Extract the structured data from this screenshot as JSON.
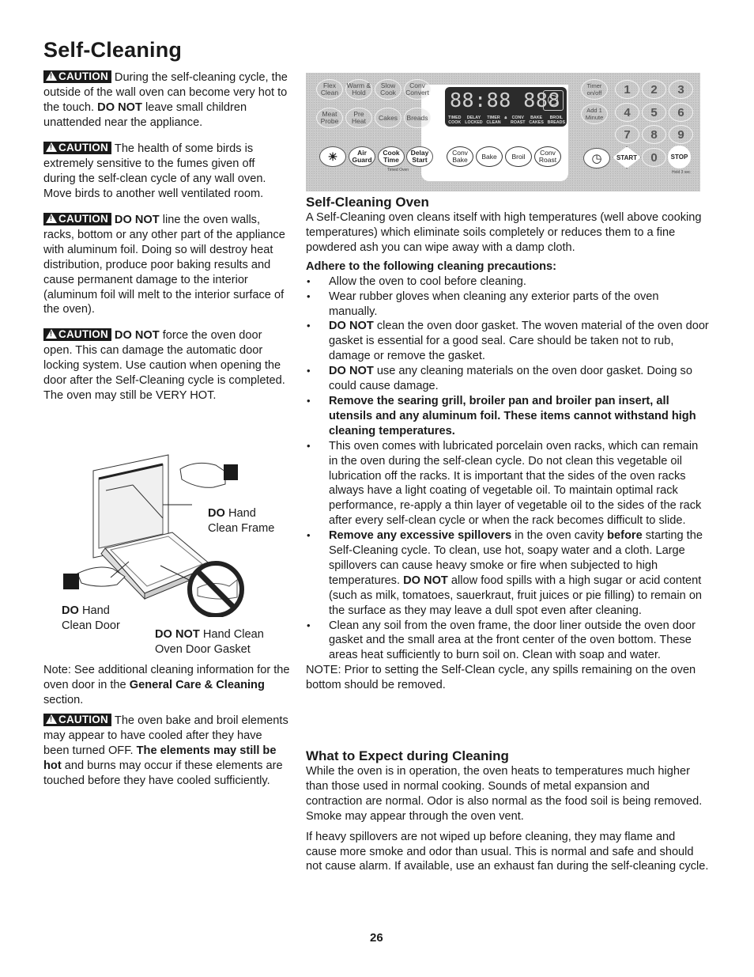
{
  "page": {
    "title": "Self-Cleaning",
    "page_number": "26"
  },
  "left_column": {
    "caution_label": "CAUTION",
    "cautions": [
      {
        "lead_bold": "",
        "text_1": "During the self-cleaning cycle, the outside of the wall oven can become very hot to the touch. ",
        "bold_1": "DO NOT",
        "text_2": " leave small children unattended near the appliance."
      },
      {
        "text": "The health of some birds is extremely sensitive to the fumes given off during the self-clean cycle of any wall oven. Move birds to another well ventilated room."
      },
      {
        "lead_bold": "DO NOT",
        "text": " line the oven walls, racks, bottom or any other part of the appliance with aluminum foil. Doing so will destroy heat distribution, produce poor baking results and cause permanent damage to the interior (aluminum foil will melt to the interior surface of the oven)."
      },
      {
        "lead_bold": "DO NOT",
        "text": " force the oven door open. This can damage the automatic door locking system. Use caution when opening the door after the Self-Cleaning cycle is completed. The oven may still be VERY HOT."
      }
    ],
    "illustration": {
      "frame_label_bold": "DO",
      "frame_label_1": " Hand",
      "frame_label_2": "Clean Frame",
      "door_label_bold": "DO",
      "door_label_1": " Hand",
      "door_label_2": "Clean Door",
      "gasket_label_bold": "DO NOT",
      "gasket_label_1": " Hand Clean",
      "gasket_label_2": "Oven Door Gasket"
    },
    "note": {
      "text_1": "Note: See additional cleaning information for the oven door in the ",
      "bold": "General Care & Cleaning",
      "text_2": " section."
    },
    "final_caution": {
      "text_1": "The oven bake and broil elements may appear to have cooled after they have been turned OFF. ",
      "bold": "The elements may still be hot",
      "text_2": " and burns may occur if these elements are touched before they have cooled sufficiently."
    }
  },
  "control_panel": {
    "left_buttons_row1": [
      "Flex Clean",
      "Warm & Hold",
      "Slow Cook",
      "Conv Convert"
    ],
    "left_buttons_row2": [
      "Meat Probe",
      "Pre Heat",
      "Cakes",
      "Breads"
    ],
    "left_buttons_row3": [
      "light-icon",
      "Air Guard",
      "Cook Time",
      "Delay Start"
    ],
    "timed_oven_label": "Timed Oven",
    "mode_buttons": [
      "Conv Bake",
      "Bake",
      "Broil",
      "Conv Roast"
    ],
    "display": {
      "digits": "88:88 888",
      "labels": [
        "TIMED\nCOOK",
        "DELAY\nLOCKED",
        "TIMER\nCLEAN",
        "CONV\nROAST",
        "BAKE\nCAKES",
        "BROIL\nBREADS"
      ]
    },
    "right_buttons": [
      "Timer on/off",
      "Add 1 Minute"
    ],
    "keypad": [
      "1",
      "2",
      "3",
      "4",
      "5",
      "6",
      "7",
      "8",
      "9",
      "0"
    ],
    "start_label": "START",
    "stop_label": "STOP",
    "hold_label": "Hold 3 sec"
  },
  "right_column": {
    "section1": {
      "heading": "Self-Cleaning Oven",
      "intro": "A Self-Cleaning oven cleans itself with high temperatures (well above cooking temperatures) which eliminate soils completely or reduces them to a fine powdered ash you can wipe away with a damp cloth.",
      "lead": "Adhere to the following cleaning precautions:",
      "bullets": [
        {
          "text": "Allow the oven to cool before cleaning."
        },
        {
          "text": "Wear rubber gloves when cleaning any exterior parts of the oven manually."
        },
        {
          "bold": "DO NOT",
          "text": " clean the oven door gasket. The woven material of the oven door gasket is essential for a good seal. Care should be taken not to rub, damage or remove the gasket."
        },
        {
          "bold": "DO NOT",
          "text": " use any cleaning materials on the oven door gasket. Doing so could cause damage."
        },
        {
          "bold": "Remove the searing grill, broiler pan and broiler pan insert, all utensils and any aluminum foil. These items cannot withstand high cleaning temperatures.",
          "text": ""
        },
        {
          "text": "This oven comes with lubricated porcelain oven racks, which can remain in the oven during the self-clean cycle. Do not clean this vegetable oil lubrication off the racks. It is important that the sides of the oven racks always have a light coating of vegetable oil. To maintain optimal rack performance, re-apply a thin layer of vegetable oil to the sides of the rack after every self-clean cycle or when the rack becomes difficult to slide."
        },
        {
          "bold": "Remove any excessive spillovers",
          "text": " in the oven cavity ",
          "bold_2": "before",
          "text_2": " starting the Self-Cleaning cycle. To clean, use hot, soapy water and a cloth. Large spillovers can cause heavy smoke or fire when subjected to high temperatures. ",
          "bold_3": "DO NOT",
          "text_3": " allow food spills with a high sugar or acid content (such as milk, tomatoes, sauerkraut, fruit juices or pie filling) to remain on the surface as they may leave a dull spot even after cleaning."
        },
        {
          "text": "Clean any soil from the oven frame, the door liner outside the oven door gasket and the small area at the front center of the oven bottom. These areas heat sufficiently to burn soil on. Clean with soap and water."
        }
      ],
      "note": "NOTE: Prior to setting the Self-Clean cycle, any spills remaining on the oven bottom should be removed."
    },
    "section2": {
      "heading": "What to Expect during Cleaning",
      "para1": "While the oven is in operation, the oven heats to temperatures much higher than those used in normal cooking. Sounds of metal expansion and contraction are normal. Odor is also normal as the food soil is being removed. Smoke may appear through the oven vent.",
      "para2": "If heavy spillovers are not wiped up before cleaning, they may flame and cause more smoke and odor than usual. This is normal and safe  and should not cause alarm. If available, use an exhaust fan during the self-cleaning cycle."
    }
  }
}
